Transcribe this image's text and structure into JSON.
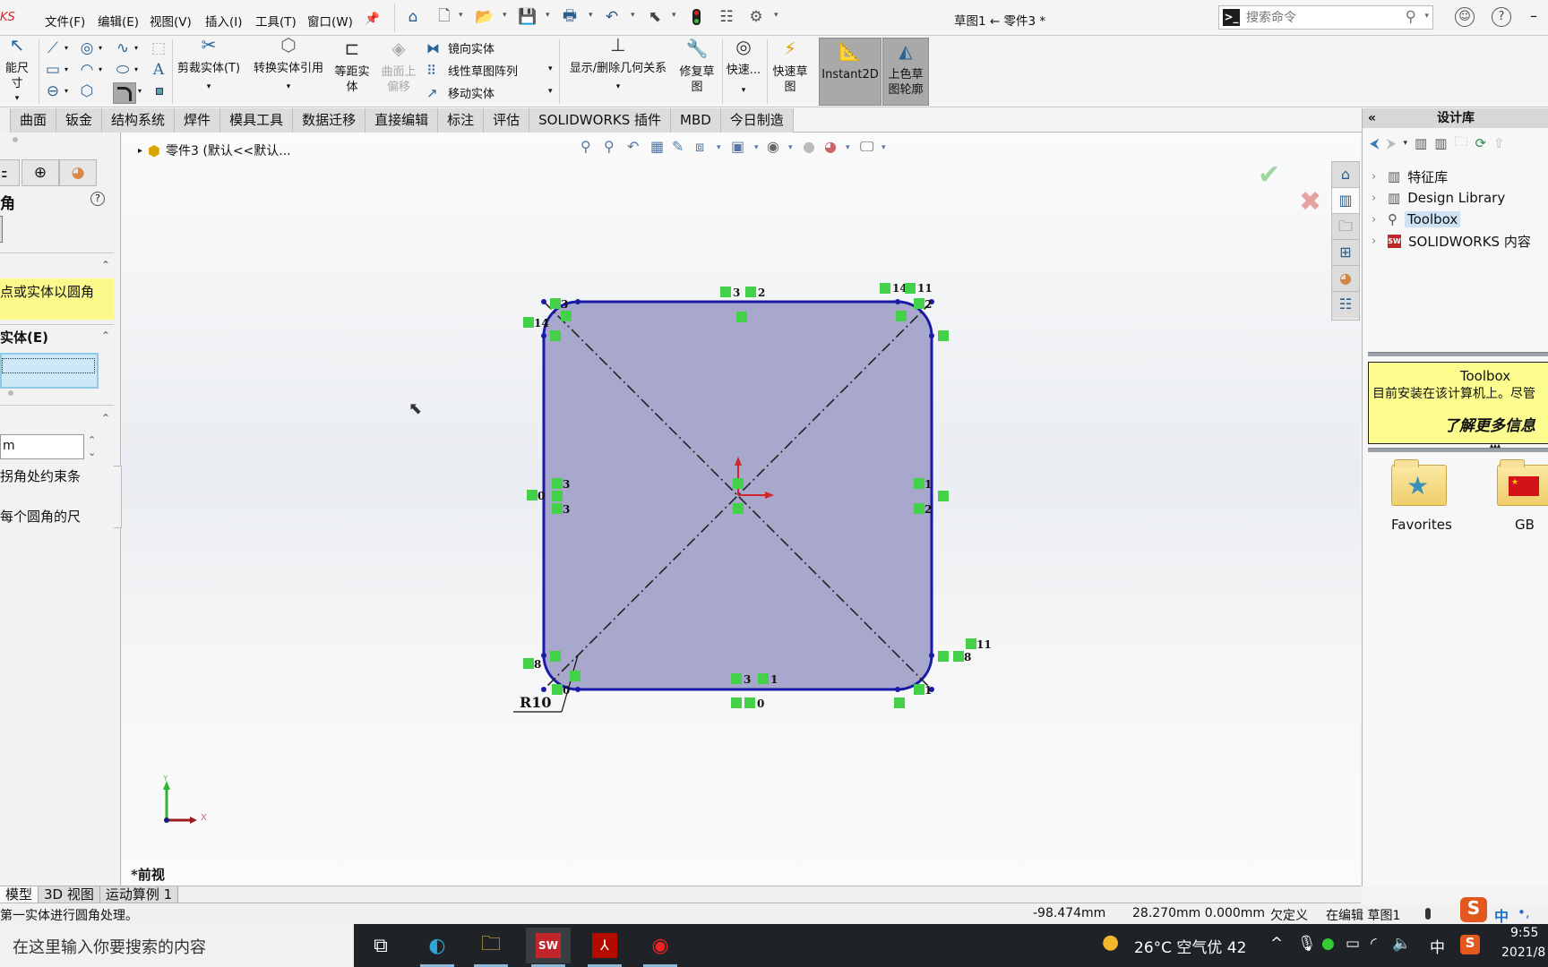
{
  "app": {
    "logo_text": "KS",
    "document_title": "草图1 ← 零件3 *"
  },
  "menu": [
    "文件(F)",
    "编辑(E)",
    "视图(V)",
    "插入(I)",
    "工具(T)",
    "窗口(W)"
  ],
  "quick_access": [
    "home-icon",
    "new-document-icon",
    "open-folder-icon",
    "save-icon",
    "print-icon",
    "undo-icon",
    "select-cursor-icon",
    "rebuild-traffic-light-icon",
    "file-properties-icon",
    "options-gear-icon"
  ],
  "search": {
    "placeholder": "搜索命令"
  },
  "ribbon": {
    "smart_dimension": "能尺寸",
    "trim": "剪裁实体(T)",
    "convert": "转换实体引用",
    "offset": "等距实体",
    "offset_surface": "曲面上偏移",
    "mirror": "镜向实体",
    "linear_pattern": "线性草图阵列",
    "move": "移动实体",
    "relations": "显示/删除几何关系",
    "repair": "修复草图",
    "quick_snaps": "快速...",
    "rapid_sketch": "快速草图",
    "instant2d": "Instant2D",
    "shaded_contours": "上色草图轮廓"
  },
  "tabs": [
    "曲面",
    "钣金",
    "结构系统",
    "焊件",
    "模具工具",
    "数据迁移",
    "直接编辑",
    "标注",
    "评估",
    "SOLIDWORKS 插件",
    "MBD",
    "今日制造"
  ],
  "property_manager": {
    "title": "角",
    "message_header": "",
    "message": "点或实体以圆角",
    "entities_header": "实体(E)",
    "radius_value": "m",
    "keep_constraint_label": "拐角处约束条",
    "dimension_each_label": "每个圆角的尺"
  },
  "viewport": {
    "tree_root": "零件3 (默认<<默认...",
    "view_name": "*前视",
    "dimension_label": "R10",
    "axis_x": "X",
    "axis_y": "Y",
    "relation_tags": [
      "3",
      "2",
      "14",
      "11",
      "2",
      "3",
      "14",
      "0",
      "3",
      "1",
      "2",
      "8",
      "11",
      "3",
      "1",
      "0",
      "8",
      "0",
      "1"
    ]
  },
  "design_library": {
    "title": "设计库",
    "items": [
      {
        "label": "特征库",
        "icon": "library-books-icon"
      },
      {
        "label": "Design Library",
        "icon": "library-books-icon"
      },
      {
        "label": "Toolbox",
        "icon": "bolt-icon",
        "selected": true
      },
      {
        "label": "SOLIDWORKS 内容",
        "icon": "solidworks-logo-icon"
      }
    ],
    "tip_title": "Toolbox",
    "tip_text": "目前安装在该计算机上。尽管",
    "tip_link": "了解更多信息",
    "folders": [
      {
        "label": "Favorites",
        "icon": "star-icon"
      },
      {
        "label": "GB",
        "icon": "china-flag-icon"
      }
    ]
  },
  "bottom_tabs": [
    "模型",
    "3D 视图",
    "运动算例 1"
  ],
  "status": {
    "hint": "第一实体进行圆角处理。",
    "x_coord": "-98.474mm",
    "y_coord": "28.270mm 0.000mm",
    "define_state": "欠定义",
    "edit_state": "在编辑 草图1"
  },
  "taskbar": {
    "search_placeholder": "在这里输入你要搜索的内容",
    "weather": "26°C 空气优 42",
    "ime": "中",
    "time": "9:55",
    "date": "2021/8"
  },
  "colors": {
    "sketch_line": "#1a1aa8",
    "sketch_fill": "#a4a4c8",
    "relation_tag": "#44d14a",
    "accent_red": "#d0262a"
  }
}
